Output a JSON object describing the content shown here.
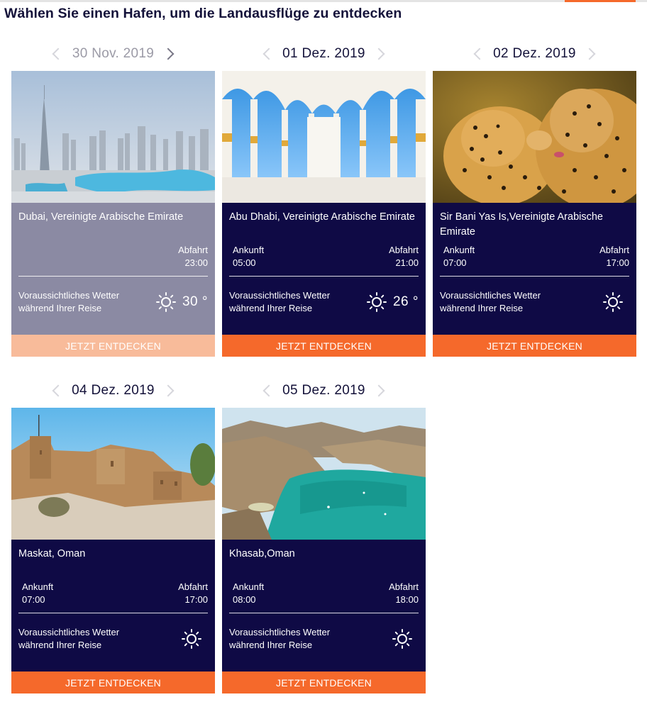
{
  "heading": "Wählen Sie einen Hafen, um die Landausflüge zu entdecken",
  "labels": {
    "arrival": "Ankunft",
    "departure": "Abfahrt",
    "weather": "Voraussichtliches Wetter während Ihrer Reise",
    "cta": "JETZT ENTDECKEN"
  },
  "colors": {
    "navy": "#0f0a45",
    "orange": "#f5692b",
    "disabled_card": "#8b8aa3",
    "disabled_cta": "#f8bb9a"
  },
  "ports": [
    {
      "date": "30 Nov. 2019",
      "port": "Dubai, Vereinigte Arabische Emirate",
      "arrival": "",
      "departure": "23:00",
      "temp": "30 °",
      "weather_icon": "sun-icon",
      "photo": "dubai-skyline"
    },
    {
      "date": "01 Dez. 2019",
      "port": "Abu Dhabi, Vereinigte Arabische Emirate",
      "arrival": "05:00",
      "departure": "21:00",
      "temp": "26 °",
      "weather_icon": "sun-icon",
      "photo": "mosque-arches"
    },
    {
      "date": "02 Dez. 2019",
      "port": "Sir Bani Yas Is,Vereinigte Arabische Emirate",
      "arrival": "07:00",
      "departure": "17:00",
      "temp": "",
      "weather_icon": "sun-icon",
      "photo": "cheetahs"
    },
    {
      "date": "04 Dez. 2019",
      "port": "Maskat, Oman",
      "arrival": "07:00",
      "departure": "17:00",
      "temp": "",
      "weather_icon": "sun-icon",
      "photo": "fort"
    },
    {
      "date": "05 Dez. 2019",
      "port": "Khasab,Oman",
      "arrival": "08:00",
      "departure": "18:00",
      "temp": "",
      "weather_icon": "sun-icon",
      "photo": "fjord-bay"
    }
  ]
}
